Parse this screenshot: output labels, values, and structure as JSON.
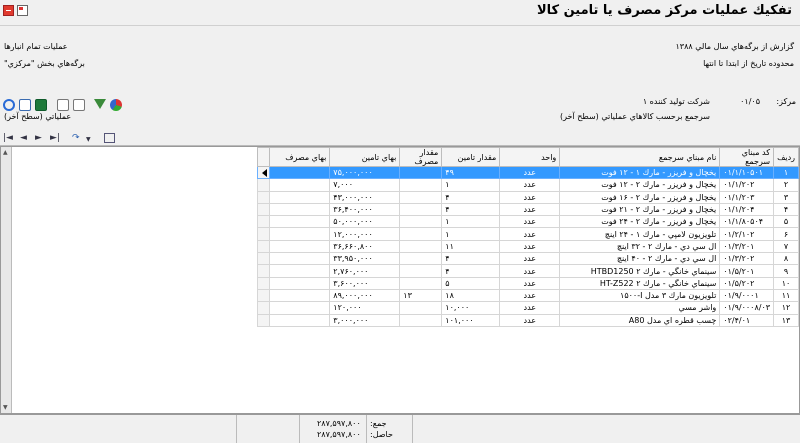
{
  "window": {
    "title": "تفكيك عمليات مركز مصرف يا تامين كالا"
  },
  "header": {
    "report_label": "گزارش از برگه‌هاي سال مالي ١٣٨٨",
    "date_range_label": "محدوده تاريخ از ابتدا تا انتها",
    "all_ops_label": "عمليات تمام انبارها",
    "section_sheets_label": "برگه‌هاي بخش \"مركزي\"",
    "center_label": "مركز:",
    "center_code": "٠۵/٠١",
    "center_name": "شركت توليد كننده ١",
    "reference_label": "سرجمع برحسب كالاهاي عملياتي (سطح آخر)",
    "operational_label": "عملياتي (سطح آخر)"
  },
  "toolbar": {
    "icons": [
      "refresh-icon",
      "copy-icon",
      "excel-icon",
      "print-preview-icon",
      "export-icon",
      "filter-icon",
      "chart-icon"
    ]
  },
  "nav": {
    "icons": [
      "first-icon",
      "prev-icon",
      "next-icon",
      "last-icon",
      "drill-icon",
      "dropdown-icon",
      "layout-icon"
    ]
  },
  "table": {
    "columns": [
      "رديف",
      "كد مبناي سرجمع",
      "نام مبناي سرجمع",
      "واحد",
      "مقدار تامين",
      "مقدار مصرف",
      "بهاي تامين",
      "بهاي مصرف"
    ],
    "rows": [
      [
        "١",
        "٠١/١/١٠۵٠١",
        "يخچال و فريزر - مارك ١ - ١٢ فوت",
        "عدد",
        "۴٩",
        "",
        "٧۵,٠٠٠,٠٠٠",
        ""
      ],
      [
        "٢",
        "٠١/١/٢٠٢",
        "يخچال و فريزر - مارك ٢ - ١٢ فوت",
        "عدد",
        "١",
        "",
        "٧,٠٠٠",
        ""
      ],
      [
        "٣",
        "٠١/١/٢٠٣",
        "يخچال و فريزر - مارك ٢ - ١۶ فوت",
        "عدد",
        "۴",
        "",
        "۴٣,٠٠٠,٠٠٠",
        ""
      ],
      [
        "۴",
        "٠١/١/٢٠۴",
        "يخچال و فريزر - مارك ٢ - ٢١ فوت",
        "عدد",
        "۴",
        "",
        "٣۶,۴٠٠,٠٠٠",
        ""
      ],
      [
        "۵",
        "٠١/١/٨٠۵٠۴",
        "يخچال و فريزر - مارك ٢ - ٢۴ فوت",
        "عدد",
        "١",
        "",
        "۵٠,٠٠٠,٠٠٠",
        ""
      ],
      [
        "۶",
        "٠١/٢/١٠٢",
        "تلويزيون لامپي - مارك ١ - ٢۴ اينچ",
        "عدد",
        "١",
        "",
        "١٢,٠٠٠,٠٠٠",
        ""
      ],
      [
        "٧",
        "٠١/٣/٢٠١",
        "ال سي دي - مارك ٢ - ٣٢ اينچ",
        "عدد",
        "١١",
        "",
        "٣۶,۶۶٠,٨٠٠",
        ""
      ],
      [
        "٨",
        "٠١/٣/٢٠٢",
        "ال سي دي - مارك ٢ - ۴٠ اينچ",
        "عدد",
        "۴",
        "",
        "٣٣,٩۵٠,٠٠٠",
        ""
      ],
      [
        "٩",
        "٠١/۵/٢٠١",
        "سينماي خانگي - مارك ٢ HTBD1250",
        "عدد",
        "۴",
        "",
        "٢,٧۶٠,٠٠٠",
        ""
      ],
      [
        "١٠",
        "٠١/۵/٢٠٢",
        "سينماي خانگي - مارك ٢ HT-Z522",
        "عدد",
        "۵",
        "",
        "٣,۶٠٠,٠٠٠",
        ""
      ],
      [
        "١١",
        "٠١/٩/٠٠٠١",
        "تلويزيون مارك ٣ مدل I-١۵٠٠",
        "عدد",
        "١٨",
        "١٣",
        "٨٩,٠٠٠,٠٠٠",
        ""
      ],
      [
        "١٢",
        "٠١/٩/٠٠٠٨/٠٣",
        "واشر مسي",
        "عدد",
        "١٠,٠٠٠",
        "",
        "١٢٠,٠٠٠",
        ""
      ],
      [
        "١٣",
        "٠٢/۴/٠١",
        "چسب قطره اي مدل A80",
        "عدد",
        "١٠١,٠٠٠",
        "",
        "٣,٠٠٠,٠٠٠",
        ""
      ]
    ]
  },
  "footer": {
    "sum_label": "جمع:",
    "sum_value": "٢٨٧,۵٩٧,٨٠٠",
    "result_label": "حاصل:",
    "result_value": "٢٨٧,۵٩٧,٨٠٠"
  }
}
